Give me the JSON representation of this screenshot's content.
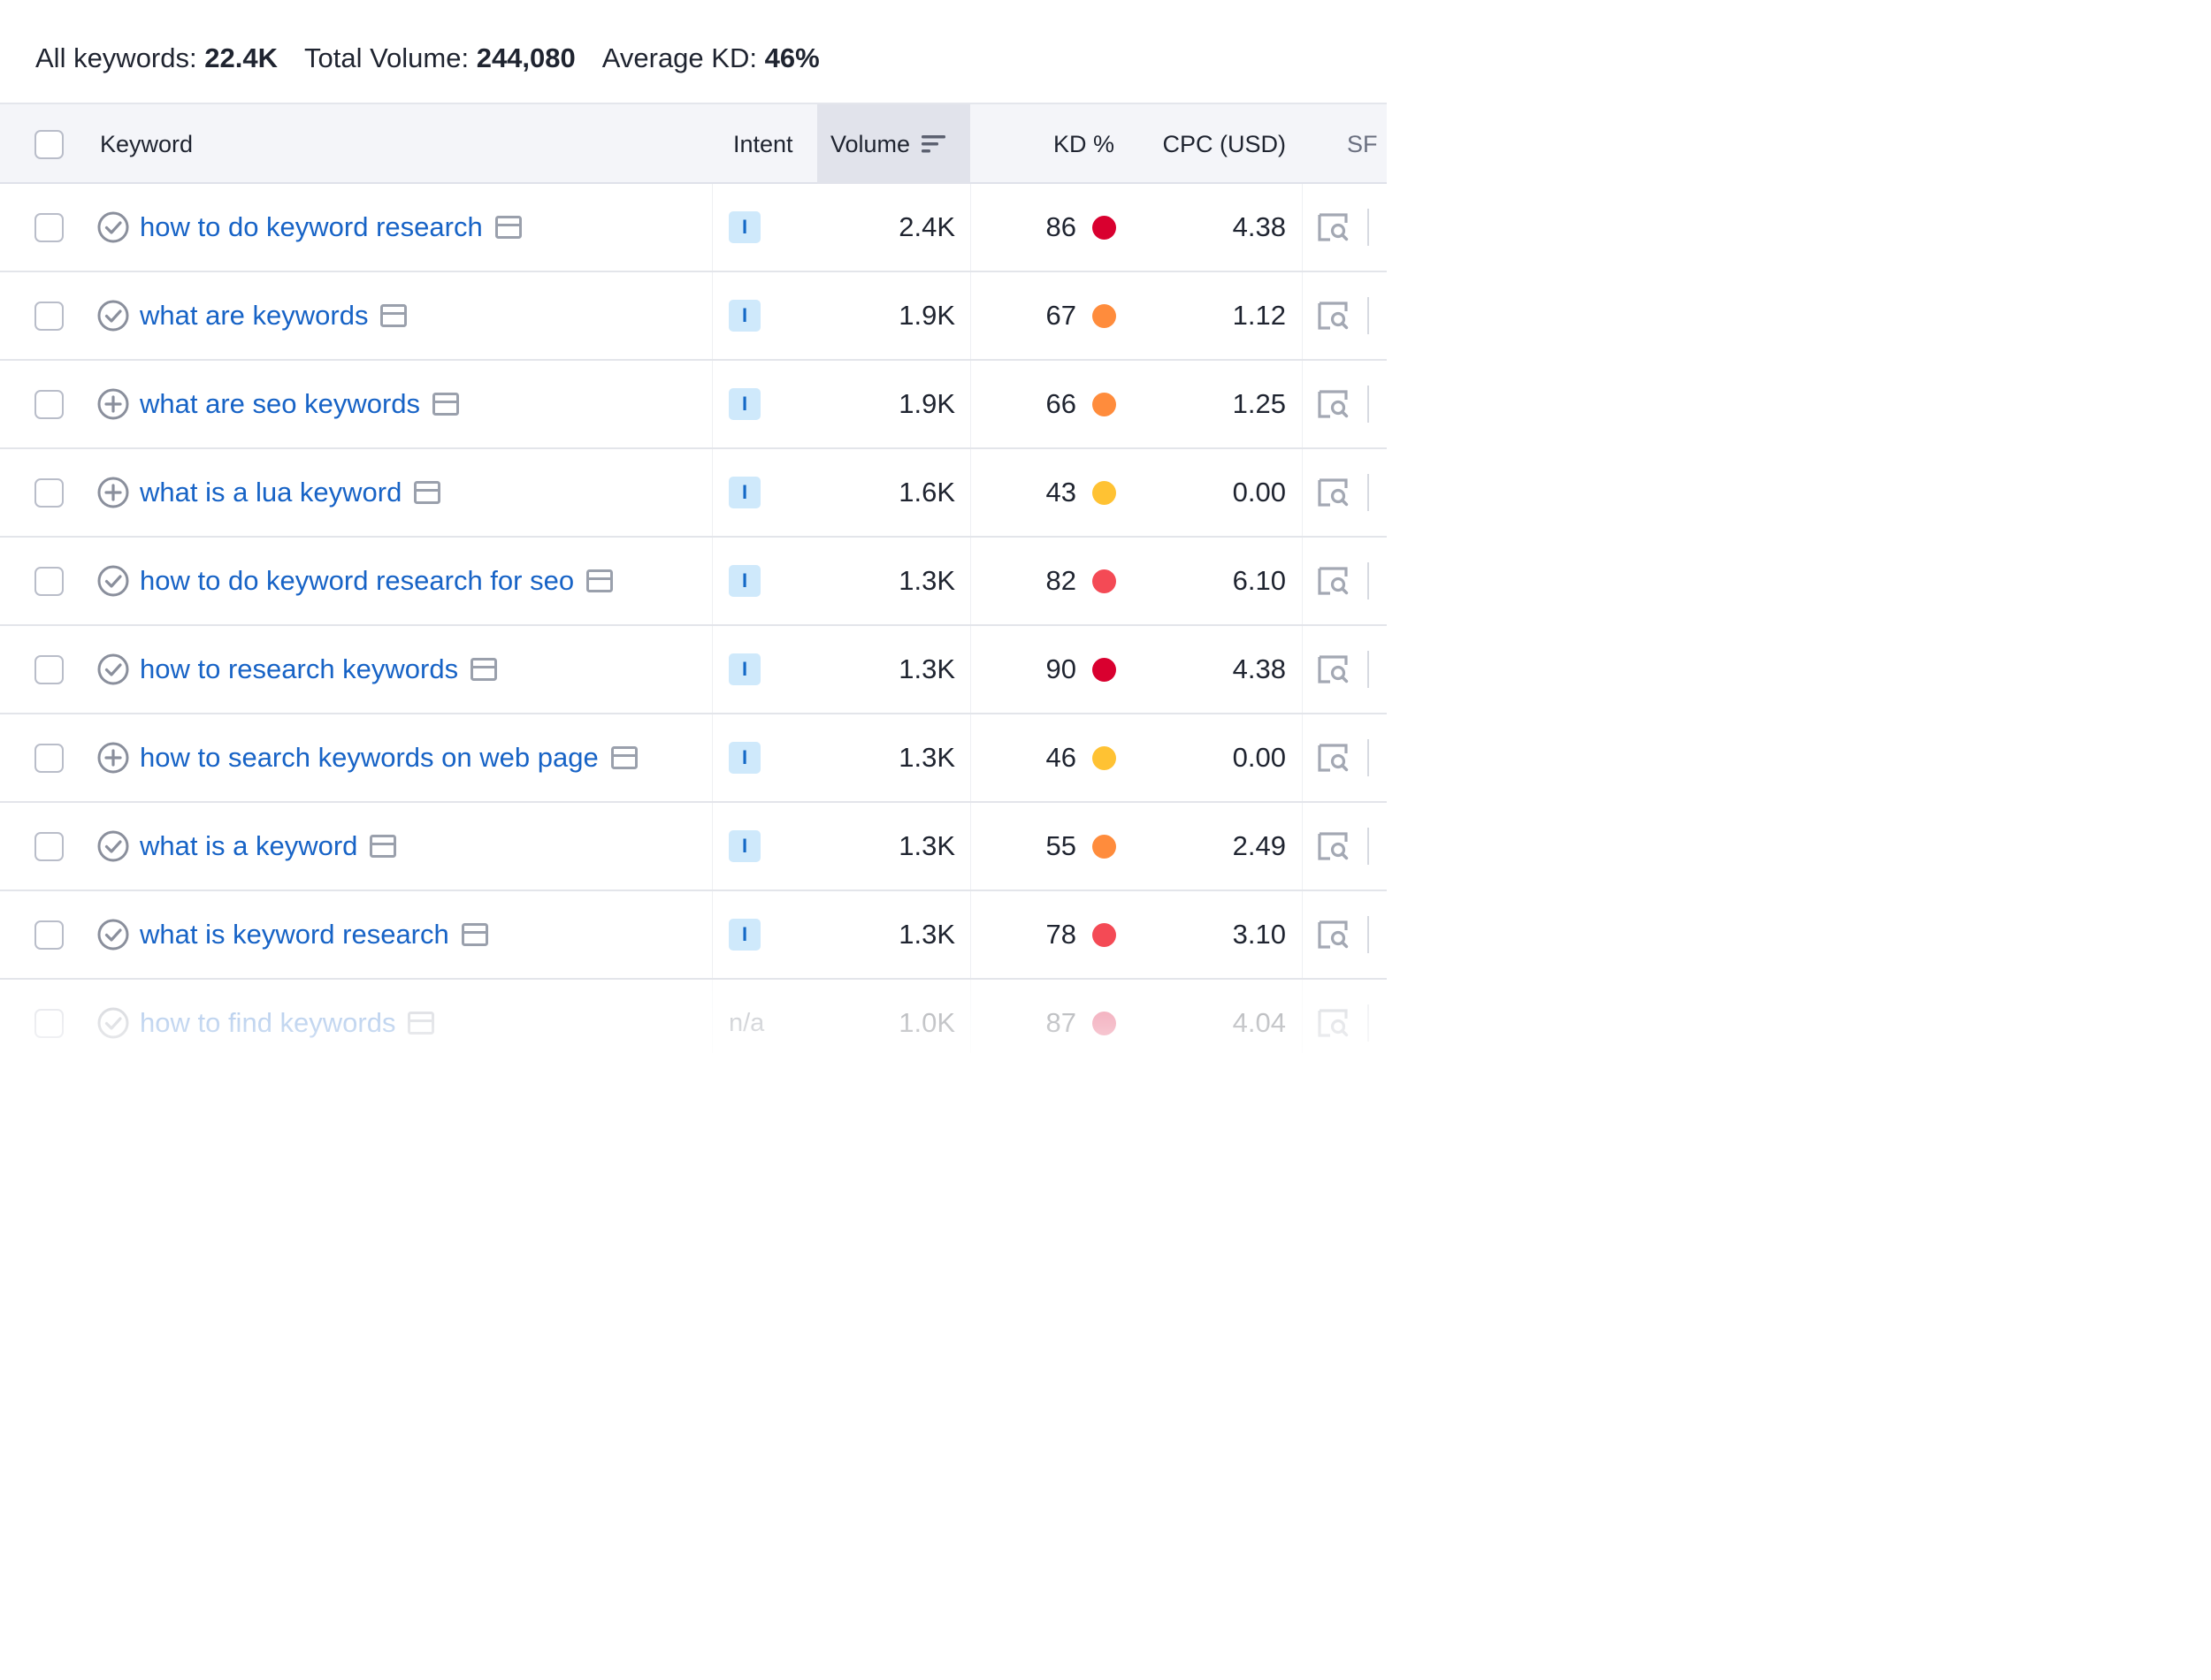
{
  "summary": {
    "all_keywords_label": "All keywords:",
    "all_keywords_value": "22.4K",
    "total_volume_label": "Total Volume:",
    "total_volume_value": "244,080",
    "average_kd_label": "Average KD:",
    "average_kd_value": "46%"
  },
  "columns": {
    "keyword": "Keyword",
    "intent": "Intent",
    "volume": "Volume",
    "kd": "KD %",
    "cpc": "CPC (USD)",
    "sf": "SF"
  },
  "colors": {
    "link": "#1763c6",
    "kd_very_hard": "#d9002f",
    "kd_hard": "#f44a55",
    "kd_difficult": "#ff8c3c",
    "kd_possible": "#ffc233",
    "intent_badge_bg": "#cfe9fb",
    "intent_badge_text": "#1469c6"
  },
  "rows": [
    {
      "keyword": "how to do keyword research",
      "status": "check",
      "intent": "I",
      "volume": "2.4K",
      "kd": "86",
      "kd_color": "#d9002f",
      "cpc": "4.38"
    },
    {
      "keyword": "what are keywords",
      "status": "check",
      "intent": "I",
      "volume": "1.9K",
      "kd": "67",
      "kd_color": "#ff8c3c",
      "cpc": "1.12"
    },
    {
      "keyword": "what are seo keywords",
      "status": "plus",
      "intent": "I",
      "volume": "1.9K",
      "kd": "66",
      "kd_color": "#ff8c3c",
      "cpc": "1.25"
    },
    {
      "keyword": "what is a lua keyword",
      "status": "plus",
      "intent": "I",
      "volume": "1.6K",
      "kd": "43",
      "kd_color": "#ffc233",
      "cpc": "0.00"
    },
    {
      "keyword": "how to do keyword research for seo",
      "status": "check",
      "intent": "I",
      "volume": "1.3K",
      "kd": "82",
      "kd_color": "#f44a55",
      "cpc": "6.10"
    },
    {
      "keyword": "how to research keywords",
      "status": "check",
      "intent": "I",
      "volume": "1.3K",
      "kd": "90",
      "kd_color": "#d9002f",
      "cpc": "4.38"
    },
    {
      "keyword": "how to search keywords on web page",
      "status": "plus",
      "intent": "I",
      "volume": "1.3K",
      "kd": "46",
      "kd_color": "#ffc233",
      "cpc": "0.00"
    },
    {
      "keyword": "what is a keyword",
      "status": "check",
      "intent": "I",
      "volume": "1.3K",
      "kd": "55",
      "kd_color": "#ff8c3c",
      "cpc": "2.49"
    },
    {
      "keyword": "what is keyword research",
      "status": "check",
      "intent": "I",
      "volume": "1.3K",
      "kd": "78",
      "kd_color": "#f44a55",
      "cpc": "3.10"
    },
    {
      "keyword": "how to find keywords",
      "status": "check",
      "intent": "n/a",
      "volume": "1.0K",
      "kd": "87",
      "kd_color": "#d9002f",
      "cpc": "4.04"
    }
  ]
}
